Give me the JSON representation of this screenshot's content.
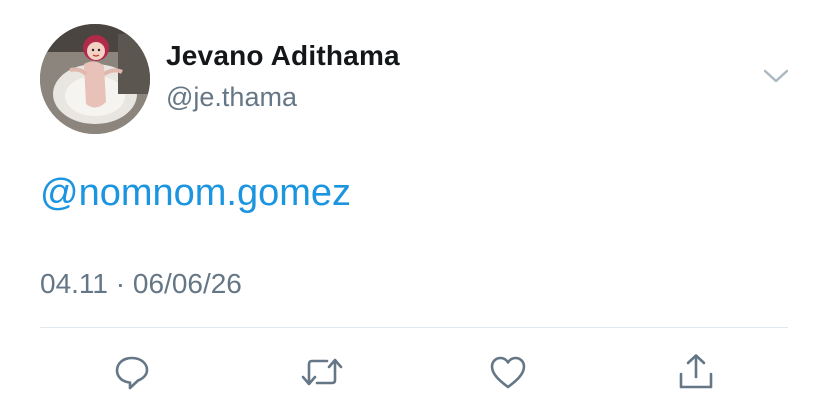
{
  "author": {
    "display_name": "Jevano Adithama",
    "handle": "@je.thama",
    "avatar_icon": "avatar-photo"
  },
  "tweet": {
    "mention": "@nomnom.gomez",
    "time": "04.11",
    "separator": "·",
    "date": "06/06/26"
  },
  "colors": {
    "link": "#1b95e0",
    "secondary_text": "#657786",
    "primary_text": "#14171a",
    "divider": "#e1e8ed"
  },
  "actions": [
    {
      "icon": "reply-icon"
    },
    {
      "icon": "retweet-icon"
    },
    {
      "icon": "like-icon"
    },
    {
      "icon": "share-icon"
    }
  ],
  "menu": {
    "icon": "chevron-down-icon"
  }
}
